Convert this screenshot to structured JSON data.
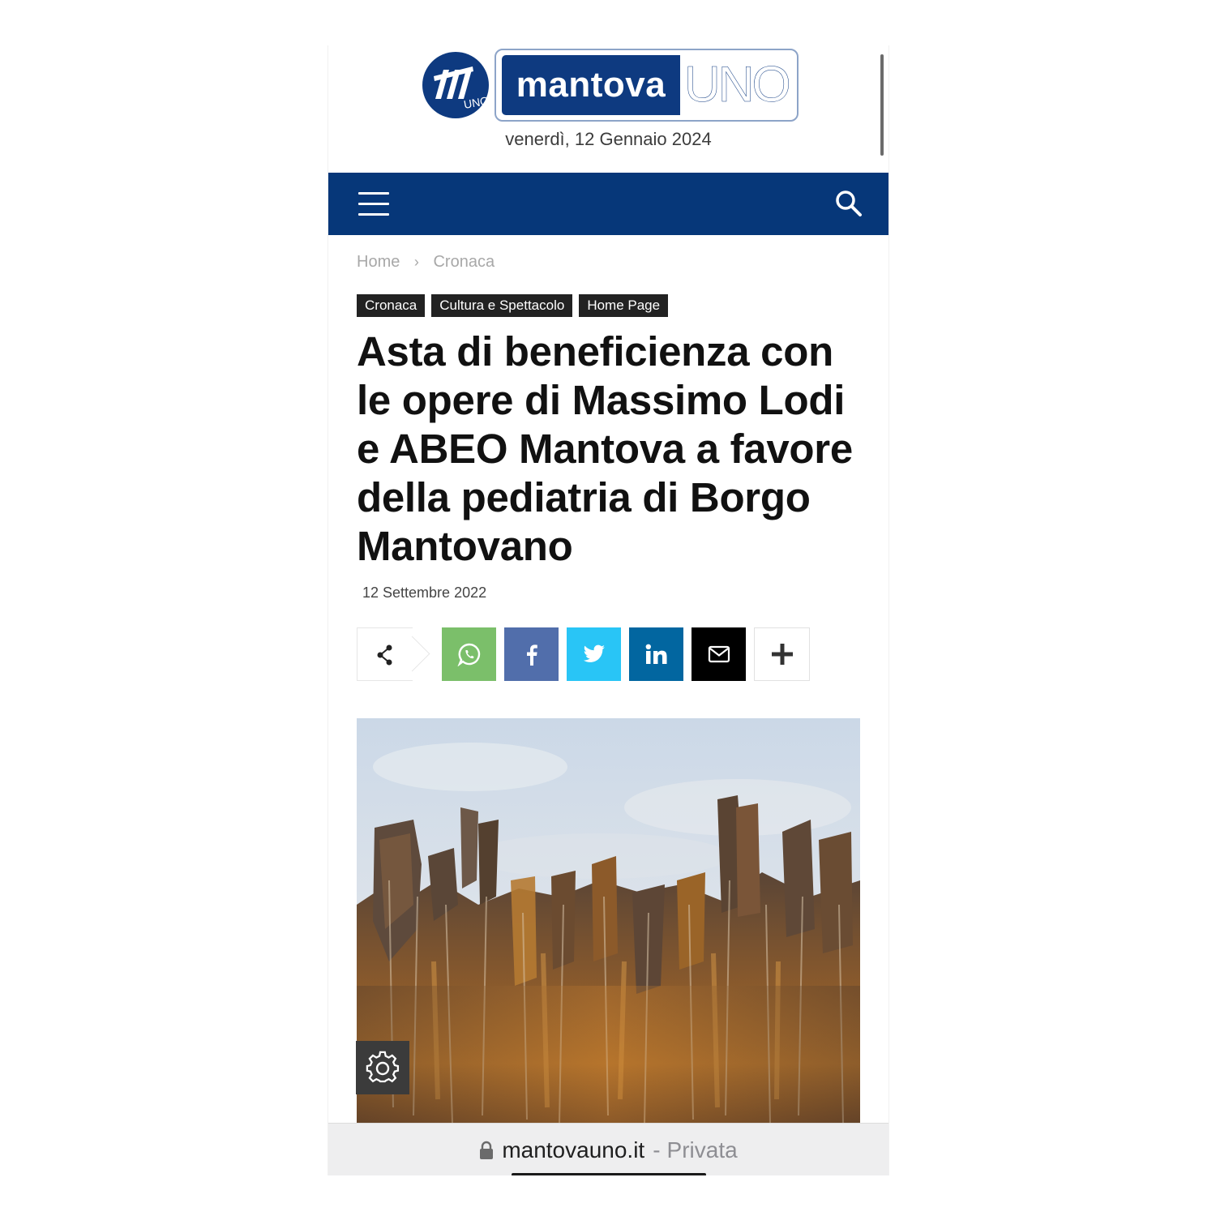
{
  "header": {
    "logo_name": "mantova",
    "logo_suffix": "UNO",
    "date": "venerdì, 12 Gennaio 2024"
  },
  "nav": {
    "menu_icon": "hamburger-menu-icon",
    "search_icon": "search-icon",
    "bar_color": "#063779"
  },
  "breadcrumb": {
    "items": [
      "Home",
      "Cronaca"
    ],
    "separator": "›"
  },
  "article": {
    "categories": [
      "Cronaca",
      "Cultura e Spettacolo",
      "Home Page"
    ],
    "title": "Asta di beneficienza con le opere di Massimo Lodi e ABEO Mantova a favore della pediatria di Borgo Mantovano",
    "date": "12 Settembre 2022"
  },
  "share": {
    "buttons": [
      {
        "name": "whatsapp",
        "icon": "whatsapp-icon",
        "color": "#7bbf6a"
      },
      {
        "name": "facebook",
        "icon": "facebook-icon",
        "color": "#516eab"
      },
      {
        "name": "twitter",
        "icon": "twitter-icon",
        "color": "#29c5f6"
      },
      {
        "name": "linkedin",
        "icon": "linkedin-icon",
        "color": "#0266a0"
      },
      {
        "name": "email",
        "icon": "mail-icon",
        "color": "#000000"
      },
      {
        "name": "more",
        "icon": "plus-icon",
        "color": "#ffffff"
      }
    ]
  },
  "settings_icon": "gear-icon",
  "browser": {
    "host": "mantovauno.it",
    "separator": "-",
    "mode": "Privata",
    "lock_icon": "lock-icon"
  }
}
